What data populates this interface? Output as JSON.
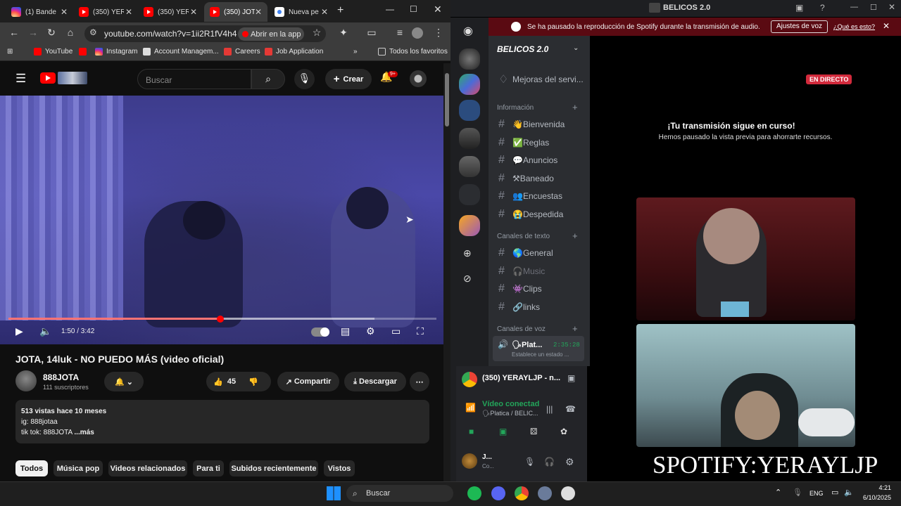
{
  "browser": {
    "tabs": [
      {
        "title": "(1) Bande",
        "icon": "instagram-icon"
      },
      {
        "title": "(350) YER",
        "icon": "youtube-icon"
      },
      {
        "title": "(350) YER",
        "icon": "youtube-icon"
      },
      {
        "title": "(350) JOTA",
        "icon": "youtube-icon",
        "active": true
      },
      {
        "title": "Nueva pe",
        "icon": "chrome-icon"
      }
    ],
    "url": "youtube.com/watch?v=1ii2R1fV4h4",
    "open_in_app": "Abrir en la app",
    "bookmarks": [
      "YouTube",
      "Instagram",
      "Account Managem...",
      "Careers",
      "Job Application"
    ],
    "all_bookmarks": "Todos los favoritos"
  },
  "youtube": {
    "search_placeholder": "Buscar",
    "create_label": "Crear",
    "notif_count": "9+",
    "player": {
      "time": "1:50 / 3:42",
      "progress": 0.495
    },
    "title": "JOTA, 14luk - NO PUEDO MÁS (video oficial)",
    "channel": {
      "name": "888JOTA",
      "subs": "111 suscriptores"
    },
    "likes": "45",
    "share_label": "Compartir",
    "download_label": "Descargar",
    "description": {
      "stats": "513 vistas  hace 10 meses",
      "line1": "ig: 888jotaa",
      "line2": "tik tok: 888JOTA ",
      "more": "...más"
    },
    "chips": [
      "Todos",
      "Música pop",
      "Videos relacionados",
      "Para ti",
      "Subidos recientemente",
      "Vistos"
    ]
  },
  "discord": {
    "window_title": "BELICOS 2.0",
    "notice": {
      "text": "Se ha pausado la reproducción de Spotify durante la transmisión de audio.",
      "button": "Ajustes de voz",
      "link": "¿Qué es esto?"
    },
    "server_name": "BELICOS 2.0",
    "partial_channel": "Mejoras del servi...",
    "categories": {
      "info": "Información",
      "text": "Canales de texto",
      "voice": "Canales de voz"
    },
    "info_channels": [
      "👋Bienvenida",
      "✅Reglas",
      "💬Anuncios",
      "⚒Baneado",
      "👥Encuestas",
      "😭Despedida"
    ],
    "text_channels": [
      "🌎General",
      "🎧Music",
      "👾Clips",
      "🔗links"
    ],
    "voice_channel": {
      "name": "🗣Plat...",
      "time": "2:35:28",
      "status": "Establece un estado ..."
    },
    "stream_tab": "(350) YERAYLJP - n...",
    "voice_connected": "Vídeo conectad",
    "voice_location": "🗣Platica / BELIC...",
    "user_short": "J...",
    "user_status": "Co...",
    "live_badge": "EN DIRECTO",
    "stream_msg_title": "¡Tu transmisión sigue en curso!",
    "stream_msg_sub": "Hemos pausado la vista previa para ahorrarte recursos.",
    "overlay_text": "SPOTIFY:YERAYLJP"
  },
  "taskbar": {
    "search": "Buscar",
    "lang": "ENG",
    "time": "4:21",
    "date": "6/10/2025"
  }
}
